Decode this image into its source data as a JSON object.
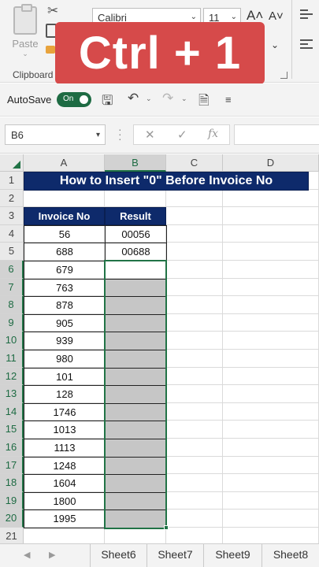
{
  "ribbon": {
    "paste_label": "Paste",
    "clipboard_label": "Clipboard",
    "font_name": "Calibri",
    "font_size": "11",
    "grow_font_glyph": "A˄",
    "shrink_font_glyph": "A˅"
  },
  "overlay": {
    "shortcut_text": "Ctrl + 1",
    "color": "#d64a4a"
  },
  "qat": {
    "autosave_label": "AutoSave",
    "toggle_state": "On"
  },
  "formula_bar": {
    "name_box": "B6",
    "fx_symbol": "fx",
    "content": ""
  },
  "sheet": {
    "columns": [
      "A",
      "B",
      "C",
      "D"
    ],
    "selected_column": "B",
    "row_numbers": [
      "1",
      "2",
      "3",
      "4",
      "5",
      "6",
      "7",
      "8",
      "9",
      "10",
      "11",
      "12",
      "13",
      "14",
      "15",
      "16",
      "17",
      "18",
      "19",
      "20",
      "21"
    ],
    "title": "How to Insert \"0\" Before  Invoice No",
    "header_invoice": "Invoice No",
    "header_result": "Result",
    "invoice_numbers": [
      "56",
      "688",
      "679",
      "763",
      "878",
      "905",
      "939",
      "980",
      "101",
      "128",
      "1746",
      "1013",
      "1113",
      "1248",
      "1604",
      "1800",
      "1995"
    ],
    "results": [
      "00056",
      "00688"
    ],
    "active_cell": "B6",
    "selection_range": "B6:B20",
    "accent_color": "#217346",
    "title_color": "#0e2a6b"
  },
  "tabs": [
    "Sheet6",
    "Sheet7",
    "Sheet9",
    "Sheet8"
  ]
}
